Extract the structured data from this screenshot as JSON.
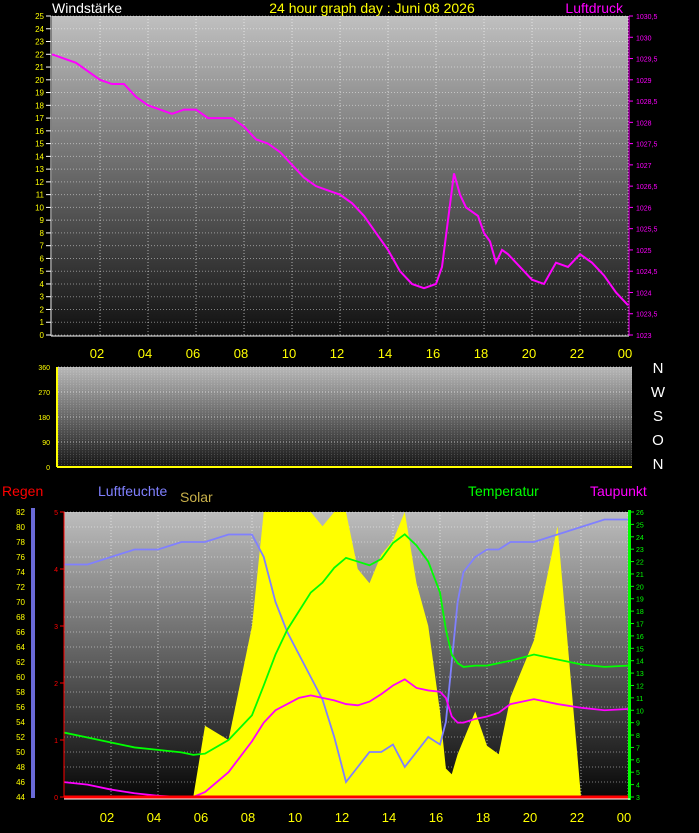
{
  "header": {
    "left_label": "Windstärke",
    "title": "24 hour graph day : Juni 08 2026",
    "right_label": "Luftdruck"
  },
  "compass": [
    "N",
    "W",
    "S",
    "O",
    "N"
  ],
  "legend2": {
    "regen": "Regen",
    "luftfeuchte": "Luftfeuchte",
    "solar": "Solar",
    "temperatur": "Temperatur",
    "taupunkt": "Taupunkt"
  },
  "colors": {
    "pressure": "#ff00ff",
    "humidity": "#8080ff",
    "solar": "#ffff00",
    "temperature": "#00ff00",
    "dewpoint": "#ff00ff",
    "rain": "#ff0000",
    "axis_text": "#ffff00"
  },
  "chart_data": [
    {
      "type": "line",
      "name": "top",
      "x_ticks": [
        "02",
        "04",
        "06",
        "08",
        "10",
        "12",
        "14",
        "16",
        "18",
        "20",
        "22",
        "00"
      ],
      "left_axis": {
        "label": "Windstärke",
        "ylim": [
          0,
          25
        ],
        "ticks": [
          "0",
          "1",
          "2",
          "3",
          "4",
          "5",
          "6",
          "7",
          "8",
          "9",
          "10",
          "11",
          "12",
          "13",
          "14",
          "15",
          "16",
          "17",
          "18",
          "19",
          "20",
          "21",
          "22",
          "23",
          "24",
          "25"
        ]
      },
      "right_axis": {
        "label": "Luftdruck",
        "ylim": [
          1023,
          1030.5
        ],
        "ticks": [
          "1023",
          "1023,5",
          "1024",
          "1024,5",
          "1025",
          "1025,5",
          "1026",
          "1026,5",
          "1027",
          "1027,5",
          "1028",
          "1028,5",
          "1029",
          "1029,5",
          "1030",
          "1030,5"
        ]
      },
      "x": [
        0,
        0.5,
        1,
        1.5,
        2,
        2.5,
        3,
        3.5,
        4,
        4.5,
        5,
        5.5,
        6,
        6.5,
        7,
        7.5,
        8,
        8.5,
        9,
        9.5,
        10,
        10.5,
        11,
        11.5,
        12,
        12.5,
        13,
        13.5,
        14,
        14.5,
        15,
        15.5,
        16,
        16.25,
        16.5,
        16.75,
        17,
        17.25,
        17.5,
        17.75,
        18,
        18.25,
        18.5,
        18.75,
        19,
        19.5,
        20,
        20.5,
        21,
        21.5,
        22,
        22.5,
        23,
        23.5,
        24
      ],
      "series": [
        {
          "name": "Luftdruck",
          "axis": "right",
          "values": [
            1029.6,
            1029.5,
            1029.4,
            1029.2,
            1029.0,
            1028.9,
            1028.9,
            1028.6,
            1028.4,
            1028.3,
            1028.2,
            1028.3,
            1028.3,
            1028.1,
            1028.1,
            1028.1,
            1027.9,
            1027.6,
            1027.5,
            1027.3,
            1027.0,
            1026.7,
            1026.5,
            1026.4,
            1026.3,
            1026.1,
            1025.8,
            1025.4,
            1025.0,
            1024.5,
            1024.2,
            1024.1,
            1024.2,
            1024.6,
            1025.7,
            1026.8,
            1026.3,
            1026.0,
            1025.9,
            1025.8,
            1025.4,
            1025.2,
            1024.7,
            1025.0,
            1024.9,
            1024.6,
            1024.3,
            1024.2,
            1024.7,
            1024.6,
            1024.9,
            1024.7,
            1024.4,
            1024.0,
            1023.7
          ]
        }
      ]
    },
    {
      "type": "line",
      "name": "wind-direction",
      "ylim": [
        0,
        360
      ],
      "y_ticks": [
        "0",
        "90",
        "180",
        "270",
        "360"
      ],
      "series": []
    },
    {
      "type": "line",
      "name": "bottom",
      "x_ticks": [
        "02",
        "04",
        "06",
        "08",
        "10",
        "12",
        "14",
        "16",
        "18",
        "20",
        "22",
        "00"
      ],
      "left_axis": {
        "label": "Luftfeuchte",
        "ylim": [
          44,
          82
        ],
        "ticks": [
          "44",
          "46",
          "48",
          "50",
          "52",
          "54",
          "56",
          "58",
          "60",
          "62",
          "64",
          "66",
          "68",
          "70",
          "72",
          "74",
          "76",
          "78",
          "80",
          "82"
        ]
      },
      "rain_axis": {
        "label": "Regen",
        "ylim": [
          0,
          5
        ],
        "ticks": [
          "0",
          "1",
          "2",
          "3",
          "4",
          "5"
        ]
      },
      "right_axis": {
        "label": "Temperatur",
        "ylim": [
          3,
          26
        ],
        "ticks": [
          "3",
          "4",
          "5",
          "6",
          "7",
          "8",
          "9",
          "10",
          "11",
          "12",
          "13",
          "14",
          "15",
          "16",
          "17",
          "18",
          "19",
          "20",
          "21",
          "22",
          "23",
          "24",
          "25",
          "26"
        ]
      },
      "x": [
        0,
        1,
        2,
        3,
        4,
        5,
        5.5,
        6,
        7,
        8,
        8.5,
        9,
        9.5,
        10,
        10.5,
        11,
        11.5,
        12,
        12.5,
        13,
        13.5,
        14,
        14.5,
        15,
        15.5,
        16,
        16.25,
        16.5,
        16.75,
        17,
        17.5,
        18,
        18.5,
        19,
        20,
        21,
        22,
        23,
        24
      ],
      "series": [
        {
          "name": "Luftfeuchte",
          "axis": "left",
          "values": [
            75,
            75,
            76,
            77,
            77,
            78,
            78,
            78,
            79,
            79,
            76,
            70,
            66,
            63,
            60,
            57,
            52,
            46,
            48,
            50,
            50,
            51,
            48,
            50,
            52,
            51,
            54,
            62,
            70,
            74,
            76,
            77,
            77,
            78,
            78,
            79,
            80,
            81,
            81
          ]
        },
        {
          "name": "Temperatur",
          "axis": "right",
          "values": [
            8.2,
            7.8,
            7.4,
            7.0,
            6.8,
            6.6,
            6.4,
            6.5,
            7.6,
            9.6,
            12.0,
            14.5,
            16.5,
            18.0,
            19.5,
            20.3,
            21.5,
            22.3,
            22.0,
            21.7,
            22.2,
            23.5,
            24.2,
            23.3,
            22.0,
            19.5,
            16.5,
            14.5,
            13.8,
            13.5,
            13.6,
            13.6,
            13.8,
            14.0,
            14.5,
            14.1,
            13.7,
            13.5,
            13.6
          ]
        },
        {
          "name": "Taupunkt",
          "axis": "right",
          "values": [
            4.2,
            4.0,
            3.6,
            3.3,
            3.1,
            3.0,
            3.0,
            3.4,
            5.0,
            7.5,
            9.0,
            10.0,
            10.5,
            11.0,
            11.2,
            11.0,
            10.8,
            10.5,
            10.4,
            10.7,
            11.3,
            12.0,
            12.5,
            11.8,
            11.6,
            11.5,
            11.0,
            9.5,
            9.0,
            9.0,
            9.3,
            9.5,
            9.8,
            10.5,
            10.9,
            10.5,
            10.2,
            10.0,
            10.1
          ]
        },
        {
          "name": "Solar",
          "axis": "fill",
          "values": [
            0,
            0,
            0,
            0,
            0,
            0,
            0,
            0.25,
            0.2,
            0.6,
            1.0,
            1.0,
            1.0,
            1.0,
            1.0,
            0.95,
            1.0,
            1.0,
            0.8,
            0.75,
            0.85,
            0.9,
            1.0,
            0.75,
            0.6,
            0.3,
            0.1,
            0.08,
            0.15,
            0.2,
            0.3,
            0.18,
            0.15,
            0.35,
            0.55,
            0.95,
            0,
            0,
            0
          ]
        },
        {
          "name": "Regen",
          "axis": "rain",
          "values": [
            0,
            0,
            0,
            0,
            0,
            0,
            0,
            0,
            0,
            0,
            0,
            0,
            0,
            0,
            0,
            0,
            0,
            0,
            0,
            0,
            0,
            0,
            0,
            0,
            0,
            0,
            0,
            0,
            0,
            0,
            0,
            0,
            0,
            0,
            0,
            0,
            0,
            0,
            0
          ]
        }
      ]
    }
  ]
}
